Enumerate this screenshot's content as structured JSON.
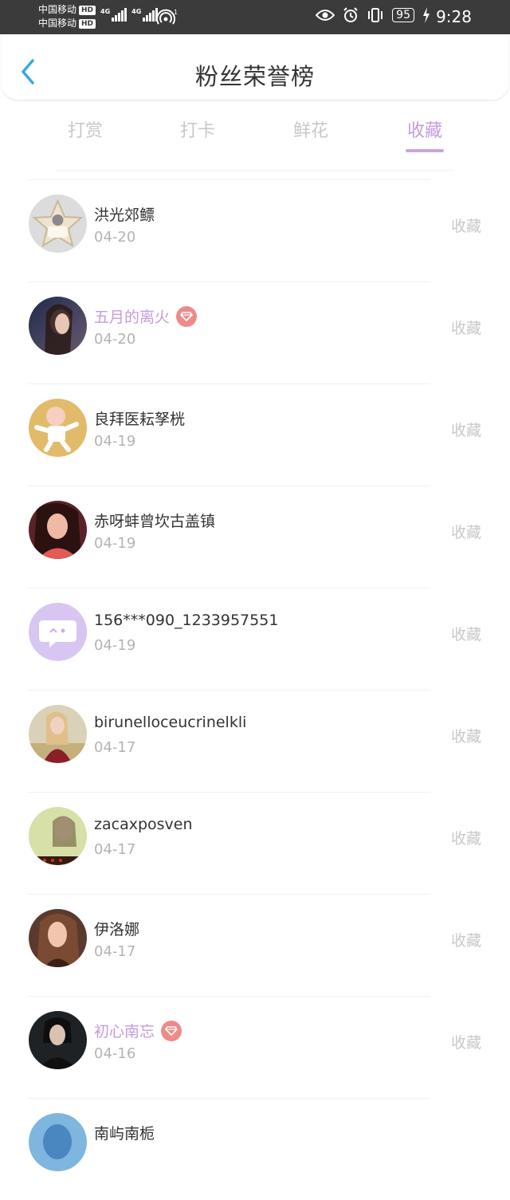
{
  "status_bar": {
    "carrier1": "中国移动",
    "carrier2": "中国移动",
    "hd": "HD",
    "net1": "4G",
    "net2": "4G",
    "hotspot_count": "1",
    "battery": "95",
    "time": "9:28"
  },
  "header": {
    "title": "粉丝荣誉榜"
  },
  "tabs": [
    {
      "label": "打赏",
      "active": false
    },
    {
      "label": "打卡",
      "active": false
    },
    {
      "label": "鲜花",
      "active": false
    },
    {
      "label": "收藏",
      "active": true
    }
  ],
  "list": [
    {
      "name": "洪光郊鳔",
      "date": "04-20",
      "action": "收藏",
      "vip": false,
      "avatar": "star-badge-avatar"
    },
    {
      "name": "五月的离火",
      "date": "04-20",
      "action": "收藏",
      "vip": true,
      "avatar": "woman-portrait-dark"
    },
    {
      "name": "良拜医耘孥桄",
      "date": "04-19",
      "action": "收藏",
      "vip": false,
      "avatar": "cartoon-kid-karate"
    },
    {
      "name": "赤呀蚌曾坎古盖镇",
      "date": "04-19",
      "action": "收藏",
      "vip": false,
      "avatar": "woman-portrait-red"
    },
    {
      "name": "156***090_1233957551",
      "date": "04-19",
      "action": "收藏",
      "vip": false,
      "avatar": "default-chat-avatar"
    },
    {
      "name": "birunelloceucrinelkli",
      "date": "04-17",
      "action": "收藏",
      "vip": false,
      "avatar": "woman-portrait-outdoor"
    },
    {
      "name": "zacaxposven",
      "date": "04-17",
      "action": "收藏",
      "vip": false,
      "avatar": "woman-portrait-green"
    },
    {
      "name": "伊洛娜",
      "date": "04-17",
      "action": "收藏",
      "vip": false,
      "avatar": "woman-portrait-brown"
    },
    {
      "name": "初心南忘",
      "date": "04-16",
      "action": "收藏",
      "vip": true,
      "avatar": "man-portrait-dark"
    },
    {
      "name": "南屿南栀",
      "date": "",
      "action": "",
      "vip": false,
      "avatar": "blue-portrait"
    }
  ],
  "colors": {
    "accent": "#c39cdc",
    "vip_badge": "#f08a8a",
    "back_arrow": "#3ba7e8",
    "status_bar_bg": "#3b3b3b"
  }
}
